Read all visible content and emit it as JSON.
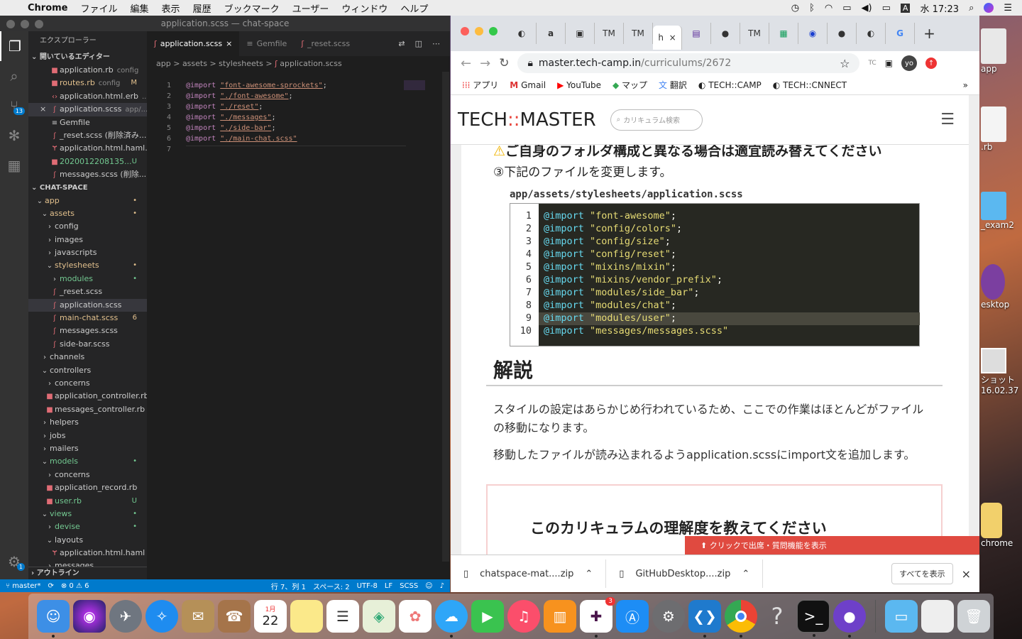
{
  "menubar": {
    "app": "Chrome",
    "items": [
      "ファイル",
      "編集",
      "表示",
      "履歴",
      "ブックマーク",
      "ユーザー",
      "ウィンドウ",
      "ヘルプ"
    ],
    "input_mode": "A",
    "clock": "水 17:23"
  },
  "desktop": {
    "items": [
      "app",
      ".rb",
      "_exam2",
      "esktop",
      "ショット",
      "16.02.37",
      "chrome"
    ]
  },
  "vscode": {
    "title": "application.scss — chat-space",
    "source_control_badge": "13",
    "settings_badge": "1",
    "explorer_title": "エクスプローラー",
    "open_editors_title": "開いているエディター",
    "open_editors": [
      {
        "name": "application.rb",
        "desc": "config",
        "status": "",
        "icon": "ruby"
      },
      {
        "name": "routes.rb",
        "desc": "config",
        "status": "M",
        "icon": "ruby"
      },
      {
        "name": "application.html.erb",
        "desc": "...",
        "status": "",
        "icon": "html"
      },
      {
        "name": "application.scss",
        "desc": "app/...",
        "status": "",
        "icon": "sass"
      },
      {
        "name": "Gemfile",
        "desc": "",
        "status": "",
        "icon": "file"
      },
      {
        "name": "_reset.scss (削除済み...",
        "desc": "",
        "status": "",
        "icon": "sass"
      },
      {
        "name": "application.html.haml...",
        "desc": "",
        "status": "",
        "icon": "haml"
      },
      {
        "name": "2020012208135...",
        "desc": "",
        "status": "U",
        "icon": "ruby"
      },
      {
        "name": "messages.scss (削除...",
        "desc": "",
        "status": "",
        "icon": "sass"
      }
    ],
    "project_title": "CHAT-SPACE",
    "tree": [
      {
        "name": "app",
        "indent": 1,
        "type": "open",
        "status": "•",
        "color": "y"
      },
      {
        "name": "assets",
        "indent": 2,
        "type": "open",
        "status": "•",
        "color": "y"
      },
      {
        "name": "config",
        "indent": 3,
        "type": "closed",
        "status": "",
        "color": "w"
      },
      {
        "name": "images",
        "indent": 3,
        "type": "closed",
        "status": "",
        "color": "w"
      },
      {
        "name": "javascripts",
        "indent": 3,
        "type": "closed",
        "status": "",
        "color": "w"
      },
      {
        "name": "stylesheets",
        "indent": 3,
        "type": "open",
        "status": "•",
        "color": "y"
      },
      {
        "name": "modules",
        "indent": 4,
        "type": "closed",
        "status": "•",
        "color": "g"
      },
      {
        "name": "_reset.scss",
        "indent": 4,
        "type": "sass",
        "status": "",
        "color": "w"
      },
      {
        "name": "application.scss",
        "indent": 4,
        "type": "sass",
        "status": "",
        "color": "w"
      },
      {
        "name": "main-chat.scss",
        "indent": 4,
        "type": "sass",
        "status": "6",
        "color": "y"
      },
      {
        "name": "messages.scss",
        "indent": 4,
        "type": "sass",
        "status": "",
        "color": "w"
      },
      {
        "name": "side-bar.scss",
        "indent": 4,
        "type": "sass",
        "status": "",
        "color": "w"
      },
      {
        "name": "channels",
        "indent": 2,
        "type": "closed",
        "status": "",
        "color": "w"
      },
      {
        "name": "controllers",
        "indent": 2,
        "type": "open",
        "status": "",
        "color": "w"
      },
      {
        "name": "concerns",
        "indent": 3,
        "type": "closed",
        "status": "",
        "color": "w"
      },
      {
        "name": "application_controller.rb",
        "indent": 3,
        "type": "ruby",
        "status": "",
        "color": "w"
      },
      {
        "name": "messages_controller.rb",
        "indent": 3,
        "type": "ruby",
        "status": "",
        "color": "w"
      },
      {
        "name": "helpers",
        "indent": 2,
        "type": "closed",
        "status": "",
        "color": "w"
      },
      {
        "name": "jobs",
        "indent": 2,
        "type": "closed",
        "status": "",
        "color": "w"
      },
      {
        "name": "mailers",
        "indent": 2,
        "type": "closed",
        "status": "",
        "color": "w"
      },
      {
        "name": "models",
        "indent": 2,
        "type": "open",
        "status": "•",
        "color": "g"
      },
      {
        "name": "concerns",
        "indent": 3,
        "type": "closed",
        "status": "",
        "color": "w"
      },
      {
        "name": "application_record.rb",
        "indent": 3,
        "type": "ruby",
        "status": "",
        "color": "w"
      },
      {
        "name": "user.rb",
        "indent": 3,
        "type": "ruby",
        "status": "U",
        "color": "g"
      },
      {
        "name": "views",
        "indent": 2,
        "type": "open",
        "status": "•",
        "color": "g"
      },
      {
        "name": "devise",
        "indent": 3,
        "type": "closed",
        "status": "•",
        "color": "g"
      },
      {
        "name": "layouts",
        "indent": 3,
        "type": "open",
        "status": "",
        "color": "w"
      },
      {
        "name": "application.html.haml",
        "indent": 4,
        "type": "haml",
        "status": "",
        "color": "w"
      },
      {
        "name": "messages",
        "indent": 3,
        "type": "closed",
        "status": "",
        "color": "w"
      }
    ],
    "outline_title": "アウトライン",
    "tabs": [
      "application.scss",
      "Gemfile",
      "_reset.scss"
    ],
    "breadcrumb": [
      "app",
      ">",
      "assets",
      ">",
      "stylesheets",
      ">",
      "application.scss"
    ],
    "code": [
      {
        "n": "1",
        "kw": "@import",
        "val": "\"font-awesome-sprockets\"",
        "end": ";"
      },
      {
        "n": "2",
        "kw": "@import",
        "val": "\"./font-awesome\"",
        "end": ";"
      },
      {
        "n": "3",
        "kw": "@import",
        "val": "\"./reset\"",
        "end": ";"
      },
      {
        "n": "4",
        "kw": "@import",
        "val": "\"./messages\"",
        "end": ";"
      },
      {
        "n": "5",
        "kw": "@import",
        "val": "\"./side-bar\"",
        "end": ";"
      },
      {
        "n": "6",
        "kw": "@import",
        "val": "\"./main-chat.scss\"",
        "end": ""
      },
      {
        "n": "7",
        "kw": "",
        "val": "",
        "end": ""
      }
    ],
    "status": {
      "branch": "master*",
      "problems": "⊗ 0 ⚠ 6",
      "position": "行 7、列 1",
      "indent": "スペース: 2",
      "encoding": "UTF-8",
      "eol": "LF",
      "language": "SCSS"
    }
  },
  "chrome": {
    "tabs": [
      "TM",
      "TM",
      "h",
      "TM"
    ],
    "url_host": "master.tech-camp.in",
    "url_path": "/curriculums/2672",
    "profile": "yo",
    "bookmarks": [
      "アプリ",
      "Gmail",
      "YouTube",
      "マップ",
      "翻訳",
      "TECH::CAMP",
      "TECH::CNNECT"
    ],
    "site": {
      "logo_a": "TECH",
      "logo_b": "::",
      "logo_c": "MASTER",
      "search_placeholder": "カリキュラム検索"
    },
    "article": {
      "cut_line": "ご自身のフォルダ構成と異なる場合は適宜読み替えてください",
      "step": "③下記のファイルを変更します。",
      "file_path": "app/assets/stylesheets/application.scss",
      "code": [
        {
          "n": "1",
          "kw": "@import",
          "val": "\"font-awesome\"",
          "end": ";"
        },
        {
          "n": "2",
          "kw": "@import",
          "val": "\"config/colors\"",
          "end": ";"
        },
        {
          "n": "3",
          "kw": "@import",
          "val": "\"config/size\"",
          "end": ";"
        },
        {
          "n": "4",
          "kw": "@import",
          "val": "\"config/reset\"",
          "end": ";"
        },
        {
          "n": "5",
          "kw": "@import",
          "val": "\"mixins/mixin\"",
          "end": ";"
        },
        {
          "n": "6",
          "kw": "@import",
          "val": "\"mixins/vendor_prefix\"",
          "end": ";"
        },
        {
          "n": "7",
          "kw": "@import",
          "val": "\"modules/side_bar\"",
          "end": ";"
        },
        {
          "n": "8",
          "kw": "@import",
          "val": "\"modules/chat\"",
          "end": ";"
        },
        {
          "n": "9",
          "kw": "@import",
          "val": "\"modules/user\"",
          "end": ";"
        },
        {
          "n": "10",
          "kw": "@import",
          "val": "\"messages/messages.scss\"",
          "end": ""
        }
      ],
      "heading": "解説",
      "para1": "スタイルの設定はあらかじめ行われているため、ここでの作業はほとんどがファイルの移動になります。",
      "para2": "移動したファイルが読み込まれるようapplication.scssにimport文を追加します。",
      "survey_title": "このカリキュラムの理解度を教えてください"
    },
    "red_bar": "クリックで出席・質問機能を表示",
    "downloads": [
      "chatspace-mat....zip",
      "GitHubDesktop....zip"
    ],
    "show_all": "すべてを表示"
  },
  "dock": {
    "calendar_month": "1月",
    "calendar_day": "22",
    "slack_badge": "3"
  }
}
